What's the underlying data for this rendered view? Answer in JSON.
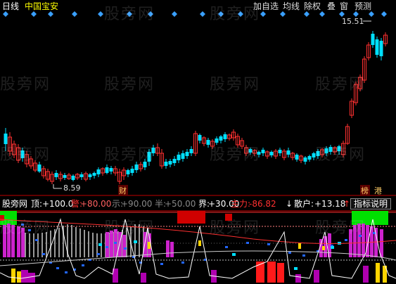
{
  "toolbar": {
    "period": "日线",
    "stock_name": "中国宝安",
    "add_watchlist": "加自选",
    "ma_line": "均线",
    "ex_rights": "除权",
    "overlay": "叠",
    "window": "窗",
    "alert": "预测"
  },
  "price_chart": {
    "high_label": "15.51",
    "low_label": "8.59",
    "finance_badge": "财",
    "rank_badge": "榜",
    "hk_badge": "港",
    "colors": {
      "up": "#ff3030",
      "down": "#00e0ff",
      "diamond": "#3aa0ff"
    }
  },
  "indicator_header": {
    "name": "股旁网",
    "items": [
      {
        "label": "顶:",
        "value": "+100.0",
        "label_color": "#ffffff",
        "value_color": "#ffffff"
      },
      {
        "label": "警:",
        "value": "+80.00",
        "label_color": "#ff3030",
        "value_color": "#ff6060"
      },
      {
        "label": "示:",
        "value": "+90.00",
        "label_color": "#888888",
        "value_color": "#888888"
      },
      {
        "label": "半:",
        "value": "+50.00",
        "label_color": "#888888",
        "value_color": "#888888"
      },
      {
        "label": "界:",
        "value": "+30.00",
        "label_color": "#ffffff",
        "value_color": "#ffffff"
      },
      {
        "label": "主力:",
        "value": "-86.82",
        "label_color": "#ff3030",
        "value_color": "#ff3030"
      },
      {
        "label": "散户:",
        "value": "+13.18",
        "label_color": "#ffffff",
        "value_color": "#ffffff"
      }
    ],
    "down_arrow": "↓",
    "up_arrow": "↑",
    "help_button": "指标说明"
  },
  "watermark": {
    "text": "股旁网"
  }
}
